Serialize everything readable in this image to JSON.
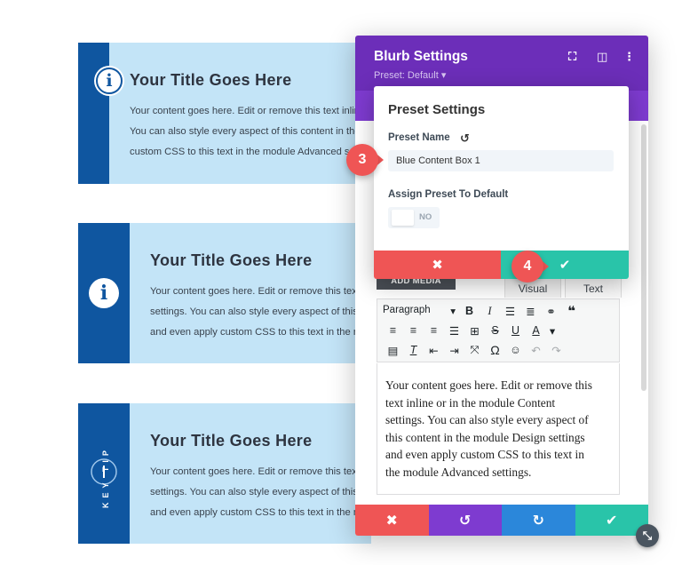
{
  "cards": [
    {
      "title": "Your Title Goes Here",
      "lines": [
        "Your content goes here. Edit or remove this text inline",
        "You can also style every aspect of this content in the",
        "custom CSS to this text in the module Advanced settings."
      ]
    },
    {
      "title": "Your Title Goes Here",
      "lines": [
        "Your content goes here. Edit or remove this text inline",
        "settings. You can also style every aspect of this content",
        "and even apply custom CSS to this text in the module"
      ]
    },
    {
      "title": "Your Title Goes Here",
      "badge": "KEY TIP",
      "lines": [
        "Your content goes here. Edit or remove this text inline",
        "settings. You can also style every aspect of this content",
        "and even apply custom CSS to this text in the module"
      ]
    }
  ],
  "panel": {
    "title": "Blurb Settings",
    "preset_label": "Preset: Default ▾",
    "add_media": "ADD MEDIA",
    "tab_visual": "Visual",
    "tab_text": "Text",
    "format_select": "Paragraph",
    "content_lines": [
      "Your content goes here. Edit or remove this",
      "text inline or in the module Content",
      "settings. You can also style every aspect of",
      "this content in the module Design settings",
      "and even apply custom CSS to this text in",
      "the module Advanced settings."
    ]
  },
  "modal": {
    "title": "Preset Settings",
    "preset_name_label": "Preset Name",
    "preset_name_value": "Blue Content Box 1",
    "assign_label": "Assign Preset To Default",
    "toggle_label": "NO"
  },
  "callouts": {
    "step3": "3",
    "step4": "4"
  },
  "icons": {
    "info": "i",
    "close": "✖",
    "check": "✔",
    "undo": "↺",
    "redo": "↻"
  },
  "colors": {
    "card_bg": "#c3e4f7",
    "card_bar": "#0f56a0",
    "panel_header": "#6c2eb9",
    "red": "#ef5555",
    "green": "#29c4a9",
    "blue": "#2b87da",
    "purple": "#7e3bd0"
  }
}
